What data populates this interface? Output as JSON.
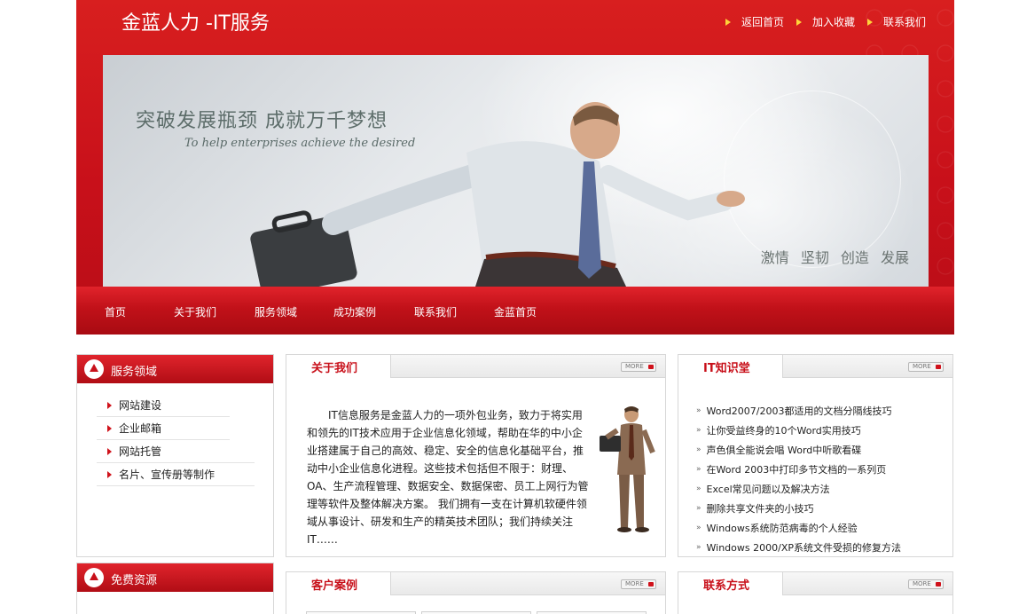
{
  "header": {
    "logo": "金蓝人力 -IT服务",
    "top_links": [
      "返回首页",
      "加入收藏",
      "联系我们"
    ]
  },
  "banner": {
    "slogan_cn": "突破发展瓶颈 成就万千梦想",
    "slogan_en": "To help enterprises achieve the desired",
    "tagline": "激情 坚韧 创造 发展"
  },
  "nav": [
    "首页",
    "关于我们",
    "服务领域",
    "成功案例",
    "联系我们",
    "金蓝首页"
  ],
  "sidebar": {
    "services": {
      "title": "服务领域",
      "items": [
        "网站建设",
        "企业邮箱",
        "网站托管",
        "名片、宣传册等制作"
      ]
    },
    "resources": {
      "title": "免费资源"
    }
  },
  "about": {
    "title": "关于我们",
    "more": "MORE",
    "text": "IT信息服务是金蓝人力的一项外包业务，致力于将实用和领先的IT技术应用于企业信息化领域，帮助在华的中小企业搭建属于自己的高效、稳定、安全的信息化基础平台，推动中小企业信息化进程。这些技术包括但不限于：财理、OA、生产流程管理、数据安全、数据保密、员工上网行为管理等软件及整体解决方案。 我们拥有一支在计算机软硬件领域从事设计、研发和生产的精英技术团队；我们持续关注IT……"
  },
  "knowledge": {
    "title": "IT知识堂",
    "more": "MORE",
    "items": [
      "Word2007/2003都适用的文档分隔线技巧",
      "让你受益终身的10个Word实用技巧",
      "声色俱全能说会唱 Word中听歌看碟",
      "在Word 2003中打印多节文档的一系列页",
      "Excel常见问题以及解决方法",
      "删除共享文件夹的小技巧",
      "Windows系统防范病毒的个人经验",
      "Windows 2000/XP系统文件受损的修复方法"
    ]
  },
  "cases": {
    "title": "客户案例",
    "more": "MORE"
  },
  "contact": {
    "title": "联系方式",
    "more": "MORE"
  }
}
